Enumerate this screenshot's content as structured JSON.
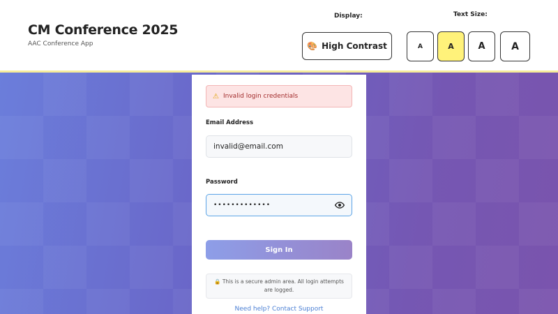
{
  "header": {
    "title": "CM Conference 2025",
    "subtitle": "AAC Conference App",
    "display_label": "Display:",
    "text_size_label": "Text Size:",
    "high_contrast_label": "High Contrast",
    "high_contrast_icon": "palette-icon",
    "text_size_options": [
      "A",
      "A",
      "A",
      "A"
    ],
    "text_size_selected_index": 1,
    "active_color": "#fff27a"
  },
  "login": {
    "error_message": "Invalid login credentials",
    "error_icon": "warning-icon",
    "email_label": "Email Address",
    "email_value": "invalid@email.com",
    "password_label": "Password",
    "password_value": "•••••••••••••",
    "signin_label": "Sign In",
    "secure_note": "This is a secure admin area. All login attempts are logged.",
    "secure_icon": "lock-icon",
    "help_link": "Need help? Contact Support"
  },
  "colors": {
    "error_bg": "#fde4e4",
    "error_text": "#a12a2a",
    "focus_border": "#5aa3e6",
    "link": "#4a7fd4"
  }
}
